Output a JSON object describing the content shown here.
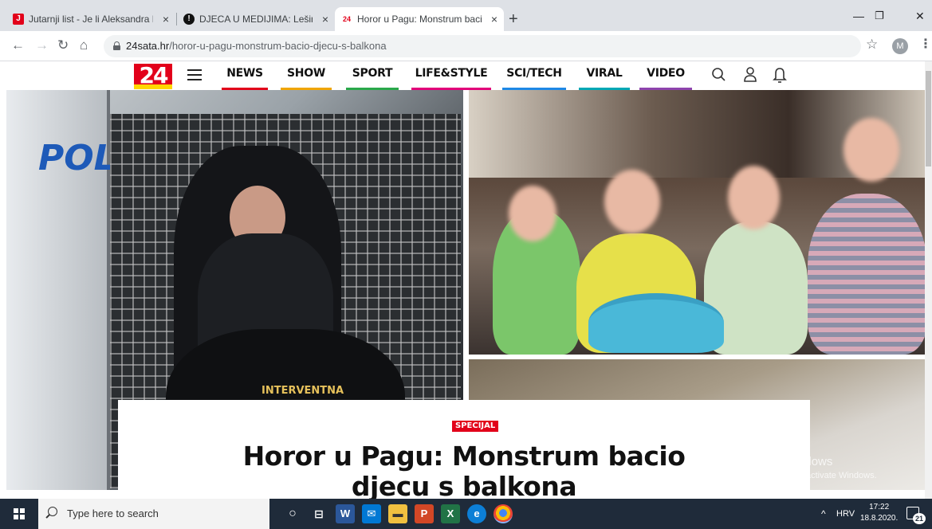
{
  "browser": {
    "tabs": [
      {
        "title": "Jutarnji list - Je li Aleksandra Pop",
        "favicon": "J",
        "favicon_color": "#e2001a"
      },
      {
        "title": "DJECA U MEDIJIMA: Lešinarenju",
        "favicon": "●",
        "favicon_color": "#111111"
      },
      {
        "title": "Horor u Pagu: Monstrum bacio d",
        "favicon": "24",
        "favicon_color": "#ffffff"
      }
    ],
    "active_tab_index": 2,
    "new_tab_icon": "plus-icon",
    "address_bar": {
      "domain": "24sata.hr",
      "path": "/horor-u-pagu-monstrum-bacio-djecu-s-balkona"
    },
    "profile_initial": "M",
    "window_controls": [
      "minimize-icon",
      "restore-icon",
      "close-icon"
    ]
  },
  "site": {
    "logo_text": "24",
    "logo_color": "#e2001a",
    "nav": [
      {
        "label": "NEWS",
        "color": "#e2001a"
      },
      {
        "label": "SHOW",
        "color": "#f0a500"
      },
      {
        "label": "SPORT",
        "color": "#2aa84a"
      },
      {
        "label": "LIFE&STYLE",
        "color": "#e2007a"
      },
      {
        "label": "SCI/TECH",
        "color": "#1e88e5"
      },
      {
        "label": "VIRAL",
        "color": "#00a8b5"
      },
      {
        "label": "VIDEO",
        "color": "#8e44ad"
      }
    ],
    "header_icons": [
      "search-icon",
      "user-icon",
      "bell-icon"
    ]
  },
  "article": {
    "tag": "SPECIJAL",
    "headline_line1": "Horor u Pagu: Monstrum bacio",
    "headline_line2": "djecu s balkona",
    "photo_left_text_poli": "POLI",
    "photo_left_text_vest": "INTERVENTNA"
  },
  "watermark": {
    "line1": "Activate Windows",
    "line2": "Go to Settings to activate Windows."
  },
  "taskbar": {
    "search_placeholder": "Type here to search",
    "language": "HRV",
    "time": "17:22",
    "date": "18.8.2020.",
    "notification_count": "21"
  }
}
